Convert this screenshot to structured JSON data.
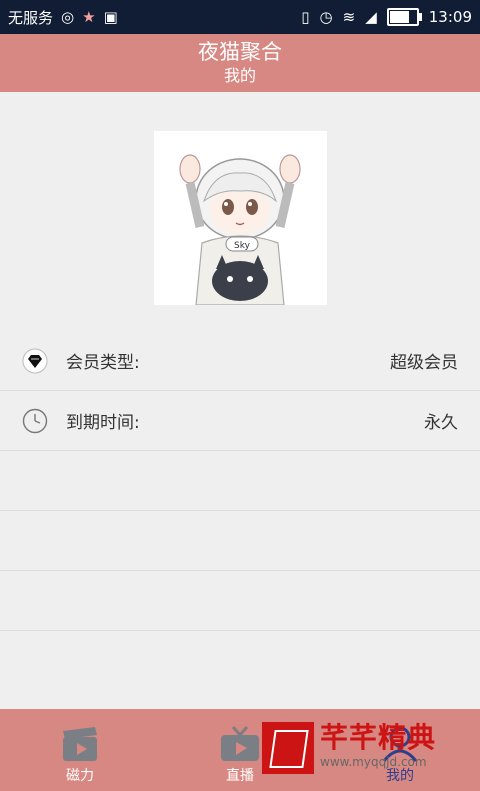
{
  "statusbar": {
    "carrier": "无服务",
    "time": "13:09"
  },
  "header": {
    "app_title": "夜猫聚合",
    "page_title": "我的"
  },
  "profile": {
    "rows": [
      {
        "icon": "diamond-icon",
        "label": "会员类型:",
        "value": "超级会员"
      },
      {
        "icon": "clock-icon",
        "label": "到期时间:",
        "value": "永久"
      }
    ]
  },
  "nav": {
    "items": [
      {
        "icon": "clapperboard-icon",
        "label": "磁力"
      },
      {
        "icon": "tv-icon",
        "label": "直播"
      },
      {
        "icon": "user-icon",
        "label": "我的"
      }
    ],
    "active": "我的"
  },
  "watermark": {
    "title": "芊芊精典",
    "url": "www.myqqjd.com"
  },
  "colors": {
    "header_bg": "#d88882",
    "statusbar_bg": "#111d35",
    "active_nav": "#2e3d8c"
  }
}
